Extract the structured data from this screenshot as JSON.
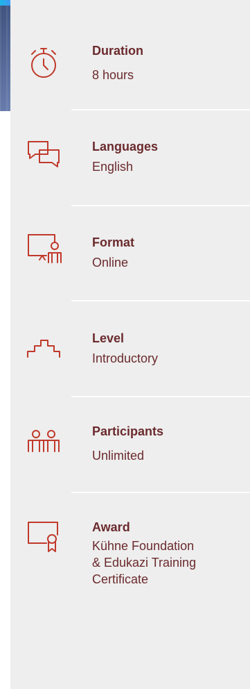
{
  "details": [
    {
      "label": "Duration",
      "value": "8 hours",
      "icon": "stopwatch-icon"
    },
    {
      "label": "Languages",
      "value": "English",
      "icon": "speech-bubbles-icon"
    },
    {
      "label": "Format",
      "value": "Online",
      "icon": "presentation-screen-icon"
    },
    {
      "label": "Level",
      "value": "Introductory",
      "icon": "stairs-icon"
    },
    {
      "label": "Participants",
      "value": "Unlimited",
      "icon": "people-icon"
    },
    {
      "label": "Award",
      "value_lines": [
        "Kühne Foundation",
        "& Edukazi Training",
        "Certificate"
      ],
      "icon": "certificate-icon"
    }
  ],
  "colors": {
    "accent": "#c0392b",
    "text": "#6b2a2d",
    "panel": "#eeeeee"
  }
}
